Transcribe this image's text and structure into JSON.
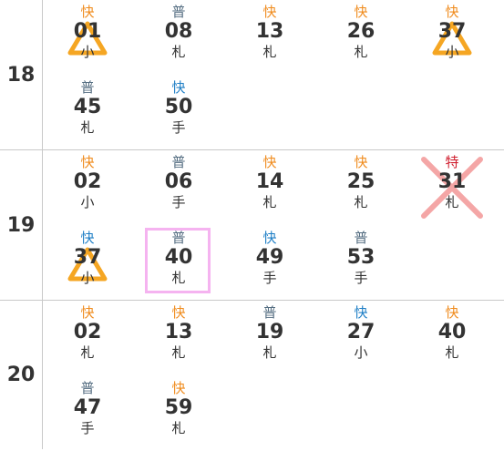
{
  "colors": {
    "rapid_orange": "#f08c1e",
    "rapid_blue": "#1f7fc6",
    "local": "#556e82",
    "limited_express": "#d02030",
    "triangle": "#f5a623",
    "cross": "#f4a6a6",
    "selected_border": "#f5b3f0"
  },
  "hours": [
    {
      "hour": "18",
      "trains": [
        {
          "type": "快",
          "type_color": "rapid_orange",
          "minute": "01",
          "dest": "小",
          "mark": "triangle"
        },
        {
          "type": "普",
          "type_color": "local",
          "minute": "08",
          "dest": "札"
        },
        {
          "type": "快",
          "type_color": "rapid_orange",
          "minute": "13",
          "dest": "札"
        },
        {
          "type": "快",
          "type_color": "rapid_orange",
          "minute": "26",
          "dest": "札"
        },
        {
          "type": "快",
          "type_color": "rapid_orange",
          "minute": "37",
          "dest": "小",
          "mark": "triangle"
        },
        {
          "type": "普",
          "type_color": "local",
          "minute": "45",
          "dest": "札"
        },
        {
          "type": "快",
          "type_color": "rapid_blue",
          "minute": "50",
          "dest": "手"
        }
      ]
    },
    {
      "hour": "19",
      "trains": [
        {
          "type": "快",
          "type_color": "rapid_orange",
          "minute": "02",
          "dest": "小"
        },
        {
          "type": "普",
          "type_color": "local",
          "minute": "06",
          "dest": "手"
        },
        {
          "type": "快",
          "type_color": "rapid_orange",
          "minute": "14",
          "dest": "札"
        },
        {
          "type": "快",
          "type_color": "rapid_orange",
          "minute": "25",
          "dest": "札"
        },
        {
          "type": "特",
          "type_color": "limited_express",
          "minute": "31",
          "dest": "札",
          "mark": "cross"
        },
        {
          "type": "快",
          "type_color": "rapid_blue",
          "minute": "37",
          "dest": "小",
          "mark": "triangle"
        },
        {
          "type": "普",
          "type_color": "local",
          "minute": "40",
          "dest": "札",
          "selected": true
        },
        {
          "type": "快",
          "type_color": "rapid_blue",
          "minute": "49",
          "dest": "手"
        },
        {
          "type": "普",
          "type_color": "local",
          "minute": "53",
          "dest": "手"
        }
      ]
    },
    {
      "hour": "20",
      "trains": [
        {
          "type": "快",
          "type_color": "rapid_orange",
          "minute": "02",
          "dest": "札"
        },
        {
          "type": "快",
          "type_color": "rapid_orange",
          "minute": "13",
          "dest": "札"
        },
        {
          "type": "普",
          "type_color": "local",
          "minute": "19",
          "dest": "札"
        },
        {
          "type": "快",
          "type_color": "rapid_blue",
          "minute": "27",
          "dest": "小"
        },
        {
          "type": "快",
          "type_color": "rapid_orange",
          "minute": "40",
          "dest": "札"
        },
        {
          "type": "普",
          "type_color": "local",
          "minute": "47",
          "dest": "手"
        },
        {
          "type": "快",
          "type_color": "rapid_orange",
          "minute": "59",
          "dest": "札"
        }
      ]
    }
  ]
}
